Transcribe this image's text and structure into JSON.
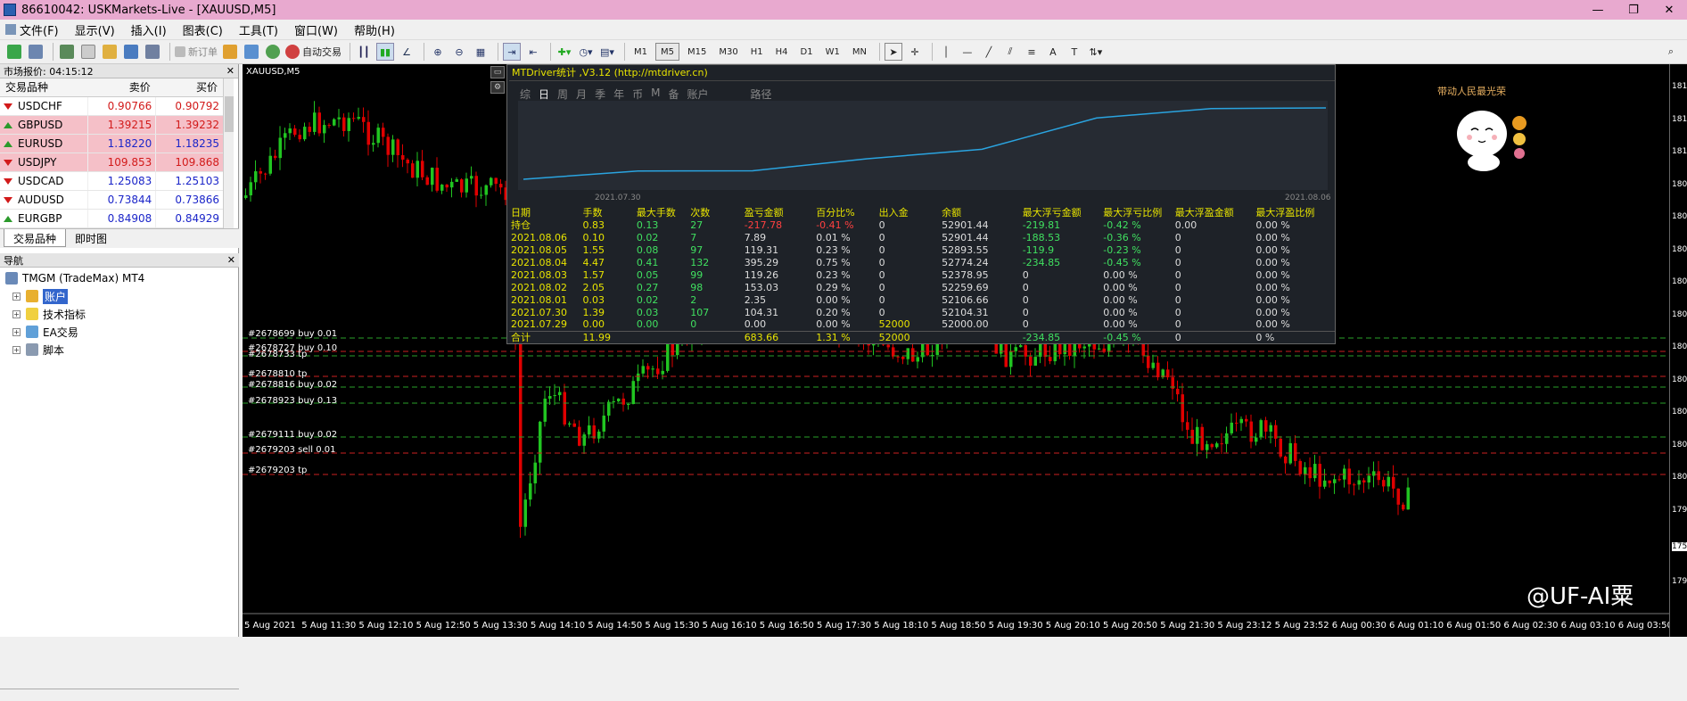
{
  "window": {
    "title": "86610042: USKMarkets-Live - [XAUUSD,M5]",
    "controls": [
      "—",
      "❐",
      "✕"
    ]
  },
  "menu": [
    "文件(F)",
    "显示(V)",
    "插入(I)",
    "图表(C)",
    "工具(T)",
    "窗口(W)",
    "帮助(H)"
  ],
  "toolbar": {
    "new_order": "新订单",
    "auto_trading": "自动交易",
    "timeframes": [
      "M1",
      "M5",
      "M15",
      "M30",
      "H1",
      "H4",
      "D1",
      "W1",
      "MN"
    ],
    "active_timeframe": "M5"
  },
  "market_watch": {
    "header": "市场报价: 04:15:12",
    "columns": [
      "交易品种",
      "卖价",
      "买价"
    ],
    "rows": [
      {
        "symbol": "USDCHF",
        "bid": "0.90766",
        "ask": "0.90792",
        "dir": "down",
        "bid_color": "red",
        "highlight": false
      },
      {
        "symbol": "GBPUSD",
        "bid": "1.39215",
        "ask": "1.39232",
        "dir": "up",
        "bid_color": "red",
        "highlight": true
      },
      {
        "symbol": "EURUSD",
        "bid": "1.18220",
        "ask": "1.18235",
        "dir": "up",
        "bid_color": "blue",
        "highlight": true
      },
      {
        "symbol": "USDJPY",
        "bid": "109.853",
        "ask": "109.868",
        "dir": "down",
        "bid_color": "red",
        "highlight": true
      },
      {
        "symbol": "USDCAD",
        "bid": "1.25083",
        "ask": "1.25103",
        "dir": "down",
        "bid_color": "blue",
        "highlight": false
      },
      {
        "symbol": "AUDUSD",
        "bid": "0.73844",
        "ask": "0.73866",
        "dir": "down",
        "bid_color": "blue",
        "highlight": false
      },
      {
        "symbol": "EURGBP",
        "bid": "0.84908",
        "ask": "0.84929",
        "dir": "up",
        "bid_color": "blue",
        "highlight": false
      }
    ],
    "tabs": [
      "交易品种",
      "即时图"
    ]
  },
  "navigator": {
    "header": "导航",
    "root": "TMGM (TradeMax) MT4",
    "items": [
      "账户",
      "技术指标",
      "EA交易",
      "脚本"
    ]
  },
  "chart": {
    "title": "XAUUSD,M5",
    "price_labels": [
      "181",
      "181",
      "181",
      "180",
      "180",
      "180",
      "180",
      "180",
      "180",
      "180",
      "180",
      "180",
      "180",
      "179",
      "175",
      "179"
    ],
    "time_labels": [
      "5 Aug 2021",
      "5 Aug 11:30",
      "5 Aug 12:10",
      "5 Aug 12:50",
      "5 Aug 13:30",
      "5 Aug 14:10",
      "5 Aug 14:50",
      "5 Aug 15:30",
      "5 Aug 16:10",
      "5 Aug 16:50",
      "5 Aug 17:30",
      "5 Aug 18:10",
      "5 Aug 18:50",
      "5 Aug 19:30",
      "5 Aug 20:10",
      "5 Aug 20:50",
      "5 Aug 21:30",
      "5 Aug 23:12",
      "5 Aug 23:52",
      "6 Aug 00:30",
      "6 Aug 01:10",
      "6 Aug 01:50",
      "6 Aug 02:30",
      "6 Aug 03:10",
      "6 Aug 03:50"
    ],
    "orders": [
      "#2678699 buy 0.01",
      "#2678727 buy 0.10",
      "#2678733 tp",
      "#2678810 tp",
      "#2678816 buy 0.02",
      "#2678923 buy 0.13",
      "#2679111 buy 0.02",
      "#2679203 sell 0.01",
      "#2679203 tp"
    ]
  },
  "mtdriver": {
    "title": "MTDriver统计 ,V3.12 (http://mtdriver.cn)",
    "tabs": [
      "综",
      "日",
      "周",
      "月",
      "季",
      "年",
      "币",
      "M",
      "备",
      "账户",
      "路径"
    ],
    "active_tab": "日",
    "curve_start_label": "2021.07.30",
    "curve_end_label": "2021.08.06",
    "columns": [
      "日期",
      "手数",
      "最大手数",
      "次数",
      "盈亏金额",
      "百分比%",
      "出入金",
      "余额",
      "最大浮亏金额",
      "最大浮亏比例",
      "最大浮盈金额",
      "最大浮盈比例"
    ],
    "rows": [
      [
        "持仓",
        "0.83",
        "0.13",
        "27",
        "-217.78",
        "-0.41 %",
        "0",
        "52901.44",
        "-219.81",
        "-0.42 %",
        "0.00",
        "0.00 %"
      ],
      [
        "2021.08.06",
        "0.10",
        "0.02",
        "7",
        "7.89",
        "0.01 %",
        "0",
        "52901.44",
        "-188.53",
        "-0.36 %",
        "0",
        "0.00 %"
      ],
      [
        "2021.08.05",
        "1.55",
        "0.08",
        "97",
        "119.31",
        "0.23 %",
        "0",
        "52893.55",
        "-119.9",
        "-0.23 %",
        "0",
        "0.00 %"
      ],
      [
        "2021.08.04",
        "4.47",
        "0.41",
        "132",
        "395.29",
        "0.75 %",
        "0",
        "52774.24",
        "-234.85",
        "-0.45 %",
        "0",
        "0.00 %"
      ],
      [
        "2021.08.03",
        "1.57",
        "0.05",
        "99",
        "119.26",
        "0.23 %",
        "0",
        "52378.95",
        "0",
        "0.00 %",
        "0",
        "0.00 %"
      ],
      [
        "2021.08.02",
        "2.05",
        "0.27",
        "98",
        "153.03",
        "0.29 %",
        "0",
        "52259.69",
        "0",
        "0.00 %",
        "0",
        "0.00 %"
      ],
      [
        "2021.08.01",
        "0.03",
        "0.02",
        "2",
        "2.35",
        "0.00 %",
        "0",
        "52106.66",
        "0",
        "0.00 %",
        "0",
        "0.00 %"
      ],
      [
        "2021.07.30",
        "1.39",
        "0.03",
        "107",
        "104.31",
        "0.20 %",
        "0",
        "52104.31",
        "0",
        "0.00 %",
        "0",
        "0.00 %"
      ],
      [
        "2021.07.29",
        "0.00",
        "0.00",
        "0",
        "0.00",
        "0.00 %",
        "52000",
        "52000.00",
        "0",
        "0.00 %",
        "0",
        "0.00 %"
      ]
    ],
    "total": [
      "合计",
      "11.99",
      "",
      "",
      "683.66",
      "1.31 %",
      "52000",
      "",
      "-234.85",
      "-0.45 %",
      "0",
      "0 %"
    ]
  },
  "mascot": {
    "caption": "带动人民最光荣"
  },
  "watermark": "@UF-AI粟"
}
